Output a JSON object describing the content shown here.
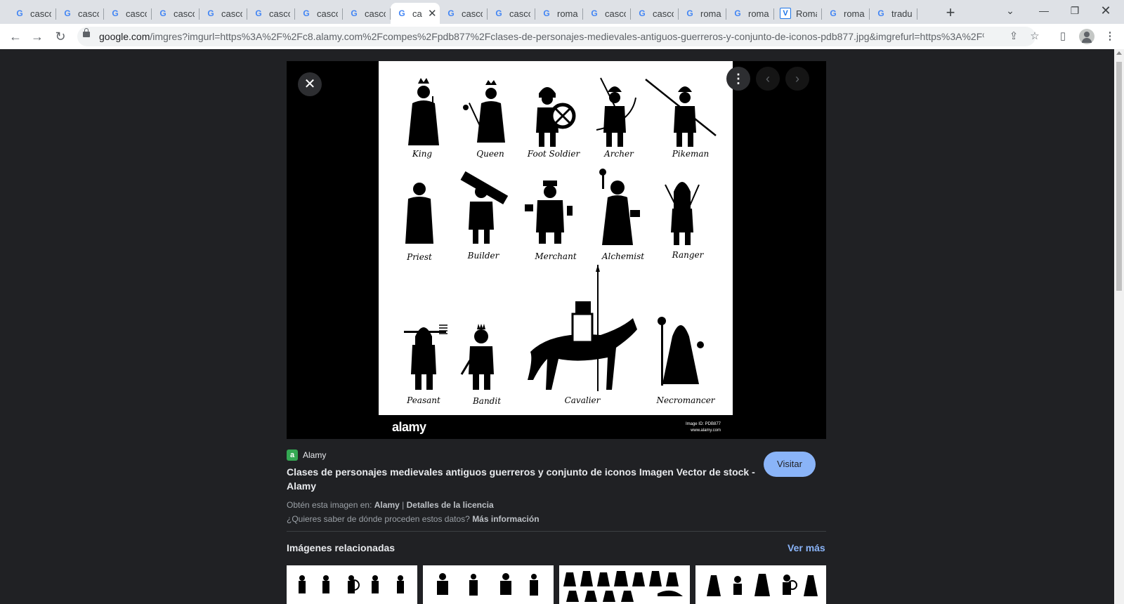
{
  "browser": {
    "tabs": [
      {
        "title": "casco",
        "favicon": "google-icon"
      },
      {
        "title": "casco",
        "favicon": "google-icon"
      },
      {
        "title": "casco",
        "favicon": "google-icon"
      },
      {
        "title": "casco",
        "favicon": "google-icon"
      },
      {
        "title": "casco",
        "favicon": "google-icon"
      },
      {
        "title": "casco",
        "favicon": "google-icon"
      },
      {
        "title": "casco",
        "favicon": "google-icon"
      },
      {
        "title": "casco",
        "favicon": "google-icon"
      },
      {
        "title": "ca",
        "favicon": "google-icon",
        "active": true
      },
      {
        "title": "casco",
        "favicon": "google-icon"
      },
      {
        "title": "casco",
        "favicon": "google-icon"
      },
      {
        "title": "roma",
        "favicon": "google-icon"
      },
      {
        "title": "casco",
        "favicon": "google-icon"
      },
      {
        "title": "casco",
        "favicon": "google-icon"
      },
      {
        "title": "roma",
        "favicon": "google-icon"
      },
      {
        "title": "roma",
        "favicon": "google-icon"
      },
      {
        "title": "Roma",
        "favicon": "vectorstock-icon"
      },
      {
        "title": "roma",
        "favicon": "google-icon"
      },
      {
        "title": "tradu",
        "favicon": "google-icon"
      }
    ],
    "url_host": "google.com",
    "url_rest": "/imgres?imgurl=https%3A%2F%2Fc8.alamy.com%2Fcompes%2Fpdb877%2Fclases-de-personajes-medievales-antiguos-guerreros-y-conjunto-de-iconos-pdb877.jpg&imgrefurl=https%3A%2F%2..."
  },
  "viewer": {
    "image_labels": {
      "row1": [
        "King",
        "Queen",
        "Foot Soldier",
        "Archer",
        "Pikeman"
      ],
      "row2": [
        "Priest",
        "Builder",
        "Merchant",
        "Alchemist",
        "Ranger"
      ],
      "row3": [
        "Peasant",
        "Bandit",
        "Cavalier",
        "Necromancer"
      ]
    },
    "watermark_logo": "alamy",
    "image_id_line": "Image ID: PDB877",
    "image_url_line": "www.alamy.com"
  },
  "result": {
    "source_name": "Alamy",
    "source_icon_letter": "a",
    "title": "Clases de personajes medievales antiguos guerreros y conjunto de iconos Imagen Vector de stock - Alamy",
    "visit_label": "Visitar",
    "get_image_prefix": "Obtén esta imagen en:",
    "get_image_source": "Alamy",
    "license_sep": "|",
    "license_link": "Detalles de la licencia",
    "data_origin_question": "¿Quieres saber de dónde proceden estos datos?",
    "more_info": "Más información"
  },
  "related": {
    "heading": "Imágenes relacionadas",
    "see_more": "Ver más"
  },
  "colors": {
    "page_bg": "#202124",
    "accent": "#8ab4f8",
    "source_green": "#34a853"
  }
}
